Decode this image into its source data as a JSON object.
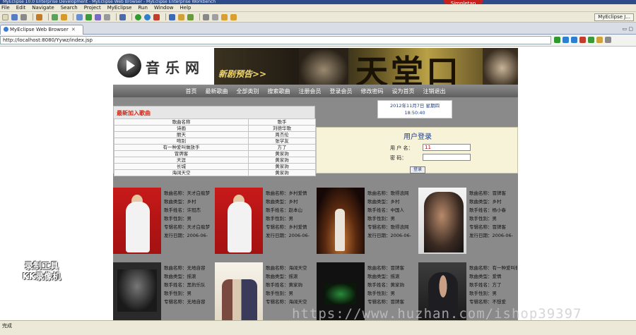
{
  "window": {
    "title": "MyEclipse 10.0 Enterprise Development - MyEclipse Web Browser - MyEclipse Enterprise Workbench",
    "promo": "Simpletap"
  },
  "menubar": [
    "File",
    "Edit",
    "Navigate",
    "Search",
    "Project",
    "MyEclipse",
    "Run",
    "Window",
    "Help"
  ],
  "toolbar": {
    "perspective": "MyEclipse J..."
  },
  "editor_tab": {
    "label": "MyEclipse Web Browser",
    "close": "✕"
  },
  "browser": {
    "url": "http://localhost:8080/Yywz/index.jsp"
  },
  "site": {
    "logo_text": "音乐网",
    "banner_text": "新剧预告>>",
    "banner_big": "天堂口",
    "nav": [
      "首页",
      "最新歌曲",
      "全部类别",
      "搜索歌曲",
      "注册会员",
      "登录会员",
      "修改密码",
      "设为首页",
      "注销退出"
    ],
    "new_songs": {
      "title": "最新加入歌曲",
      "headers": [
        "歌曲名称",
        "歌手"
      ],
      "rows": [
        [
          "诗画",
          "刘德华歌"
        ],
        [
          "丽天",
          "周杰伦"
        ],
        [
          "吻别",
          "张学友"
        ],
        [
          "有一种爱叫做放手",
          "方了"
        ],
        [
          "冒牌客",
          "黄家驹"
        ],
        [
          "天涯",
          "黄家驹"
        ],
        [
          "长城",
          "黄家驹"
        ],
        [
          "海阔天空",
          "黄家驹"
        ]
      ]
    },
    "date": {
      "line1": "2012年11月7日  星期四",
      "line2": "18:50:40"
    },
    "login": {
      "title": "用户登录",
      "username_label": "用 户 名：",
      "username_value": "11",
      "password_label": "密    码：",
      "password_value": "",
      "button": "登录"
    },
    "songs": [
      {
        "name": "歌曲名称：天才白痴梦",
        "type": "歌曲类型：乡村",
        "singer": "歌手姓名：许冠杰",
        "gender": "歌手性别：男",
        "album": "专辑名称：天才白痴梦",
        "date": "发行日期：2006-06-"
      },
      {
        "name": "歌曲名称：乡村爱情",
        "type": "歌曲类型：乡村",
        "singer": "歌手姓名：赵本山",
        "gender": "歌手性别：男",
        "album": "专辑名称：乡村爱情",
        "date": "发行日期：2006-06-"
      },
      {
        "name": "歌曲名称：歌得浪网",
        "type": "歌曲类型：乡村",
        "singer": "歌手姓名：中国人",
        "gender": "歌手性别：男",
        "album": "专辑名称：歌得浪网",
        "date": "发行日期：2006-06-"
      },
      {
        "name": "歌曲名称：冒牌客",
        "type": "歌曲类型：乡村",
        "singer": "歌手姓名：杨小春",
        "gender": "歌手性别：男",
        "album": "专辑名称：冒牌客",
        "date": "发行日期：2006-06-"
      },
      {
        "name": "歌曲名称：无地自容",
        "type": "歌曲类型：摇滚",
        "singer": "歌手姓名：黑豹乐队",
        "gender": "歌手性别：男",
        "album": "专辑名称：无地自容",
        "date": ""
      },
      {
        "name": "歌曲名称：海阔天空",
        "type": "歌曲类型：摇滚",
        "singer": "歌手姓名：黄家驹",
        "gender": "歌手性别：男",
        "album": "专辑名称：海阔天空",
        "date": ""
      },
      {
        "name": "歌曲名称：冒牌客",
        "type": "歌曲类型：摇滚",
        "singer": "歌手姓名：黄家驹",
        "gender": "歌手性别：男",
        "album": "专辑名称：冒牌客",
        "date": ""
      },
      {
        "name": "歌曲名称：有一种爱叫做放手",
        "type": "歌曲类型：爱情",
        "singer": "歌手姓名：方了",
        "gender": "歌手性别：男",
        "album": "专辑名称：不想爱",
        "date": ""
      }
    ]
  },
  "watermark": {
    "recorder_line1": "录制工具",
    "recorder_line2": "KK录像机",
    "url": "https://www.huzhan.com/ishop39397"
  },
  "statusbar": {
    "text": "完成"
  },
  "colors": {
    "nav_bg": "#6e6e6e",
    "section_title": "#cc2a1a",
    "login_bg": "#f6f3d8",
    "content_bg": "#8a8a8a"
  }
}
